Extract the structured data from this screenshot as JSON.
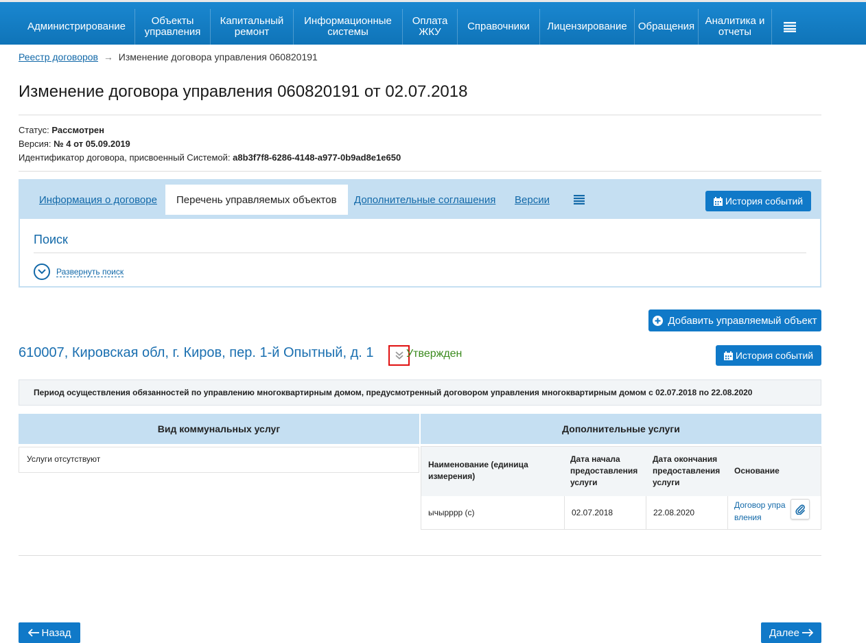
{
  "colors": {
    "nav_bg": "#1079c8",
    "link": "#1168a8",
    "tab_bar": "#c5dff2",
    "status_ok": "#3a8a1d",
    "highlight": "#e01010"
  },
  "nav": {
    "items": [
      "Администрирование",
      "Объекты управления",
      "Капитальный ремонт",
      "Информационные системы",
      "Оплата ЖКУ",
      "Справочники",
      "Лицензирование",
      "Обращения",
      "Аналитика и отчеты"
    ],
    "menu_icon": "hamburger-icon"
  },
  "breadcrumb": {
    "link": "Реестр договоров",
    "arrow": "→",
    "current": "Изменение договора управления 060820191"
  },
  "title": "Изменение договора управления 060820191 от 02.07.2018",
  "meta": {
    "status_label": "Статус:",
    "status_value": "Рассмотрен",
    "version_label": "Версия:",
    "version_value": "№ 4 от 05.09.2019",
    "id_label": "Идентификатор договора, присвоенный Системой:",
    "id_value": "a8b3f7f8-6286-4148-a977-0b9ad8e1e650"
  },
  "tabs": [
    "Информация о договоре",
    "Перечень управляемых объектов",
    "Дополнительные соглашения",
    "Версии"
  ],
  "history_button": "История событий",
  "search": {
    "title": "Поиск",
    "expand": "Развернуть поиск"
  },
  "add_object_button": "Добавить управляемый объект",
  "object": {
    "address": "610007, Кировская обл, г. Киров, пер. 1-й Опытный, д. 1",
    "status": "Утвержден"
  },
  "period_text": "Период осуществления обязанностей по управлению многоквартирным домом, предусмотренный договором управления многоквартирным домом с 02.07.2018 по 22.08.2020",
  "table": {
    "left_header": "Вид коммунальных услуг",
    "right_header": "Дополнительные услуги",
    "left_empty": "Услуги отсутствуют",
    "sub_headers": {
      "name": "Наименование (единица измерения)",
      "start": "Дата начала предоставления услуги",
      "end": "Дата окончания предоставления услуги",
      "basis": "Основание"
    },
    "row": {
      "name": "ычырррр (с)",
      "start": "02.07.2018",
      "end": "22.08.2020",
      "basis": "Договор управления"
    }
  },
  "back_button": "Назад",
  "next_button": "Далее"
}
